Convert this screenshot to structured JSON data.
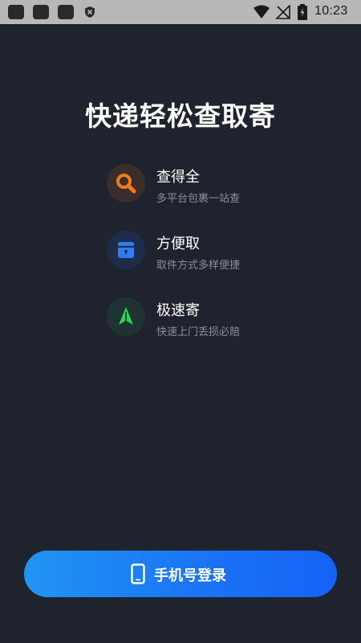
{
  "status_bar": {
    "time": "10:23",
    "icons": [
      "app-notification-icon",
      "app-notification-icon",
      "app-notification-icon",
      "shield-icon",
      "wifi-icon",
      "no-signal-icon",
      "battery-charging-icon"
    ]
  },
  "hero": {
    "title": "快递轻松查取寄"
  },
  "features": [
    {
      "title": "查得全",
      "description": "多平台包裹一站查",
      "icon": "search-icon",
      "color": "#f07d14"
    },
    {
      "title": "方便取",
      "description": "取件方式多样便捷",
      "icon": "locker-icon",
      "color": "#2f7bf5"
    },
    {
      "title": "极速寄",
      "description": "快速上门丢损必赔",
      "icon": "tree-arrow-icon",
      "color": "#2ed158"
    }
  ],
  "login": {
    "label": "手机号登录",
    "icon": "phone-icon"
  }
}
